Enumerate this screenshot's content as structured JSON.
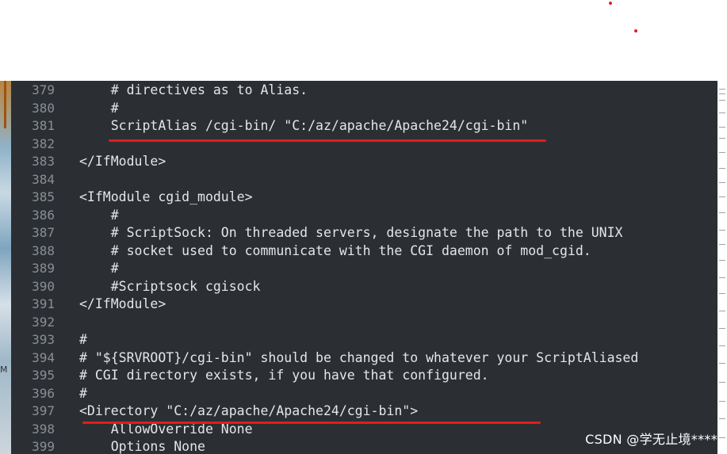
{
  "lines": [
    {
      "num": "379",
      "text": "    # directives as to Alias."
    },
    {
      "num": "380",
      "text": "    #"
    },
    {
      "num": "381",
      "text": "    ScriptAlias /cgi-bin/ \"C:/az/apache/Apache24/cgi-bin\""
    },
    {
      "num": "382",
      "text": ""
    },
    {
      "num": "383",
      "text": "</IfModule>"
    },
    {
      "num": "384",
      "text": ""
    },
    {
      "num": "385",
      "text": "<IfModule cgid_module>"
    },
    {
      "num": "386",
      "text": "    #"
    },
    {
      "num": "387",
      "text": "    # ScriptSock: On threaded servers, designate the path to the UNIX"
    },
    {
      "num": "388",
      "text": "    # socket used to communicate with the CGI daemon of mod_cgid."
    },
    {
      "num": "389",
      "text": "    #"
    },
    {
      "num": "390",
      "text": "    #Scriptsock cgisock"
    },
    {
      "num": "391",
      "text": "</IfModule>"
    },
    {
      "num": "392",
      "text": ""
    },
    {
      "num": "393",
      "text": "#"
    },
    {
      "num": "394",
      "text": "# \"${SRVROOT}/cgi-bin\" should be changed to whatever your ScriptAliased"
    },
    {
      "num": "395",
      "text": "# CGI directory exists, if you have that configured."
    },
    {
      "num": "396",
      "text": "#"
    },
    {
      "num": "397",
      "text": "<Directory \"C:/az/apache/Apache24/cgi-bin\">"
    },
    {
      "num": "398",
      "text": "    AllowOverride None"
    },
    {
      "num": "399",
      "text": "    Options None"
    }
  ],
  "watermark": "CSDN @学无止境****",
  "left_strip_marks": [
    "M"
  ],
  "colors": {
    "editor_bg": "#2b2f33",
    "code_text": "#e3e6e8",
    "line_number": "#8a8f95",
    "highlight_underline": "#e31c1c"
  }
}
